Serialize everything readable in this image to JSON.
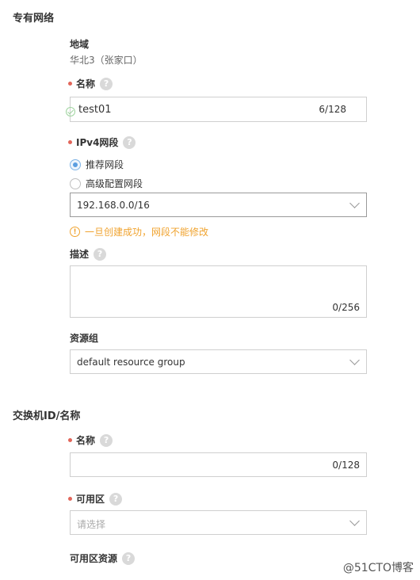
{
  "vpc": {
    "section_title": "专有网络",
    "region": {
      "label": "地域",
      "value": "华北3（张家口）"
    },
    "name": {
      "label": "名称",
      "value": "test01",
      "counter": "6/128"
    },
    "ipv4": {
      "label": "IPv4网段",
      "options": [
        {
          "label": "推荐网段",
          "checked": true
        },
        {
          "label": "高级配置网段",
          "checked": false
        }
      ],
      "selected": "192.168.0.0/16",
      "warning": "一旦创建成功，网段不能修改"
    },
    "description": {
      "label": "描述",
      "counter": "0/256"
    },
    "resource_group": {
      "label": "资源组",
      "selected": "default resource group"
    }
  },
  "vswitch": {
    "section_title": "交换机ID/名称",
    "name": {
      "label": "名称",
      "counter": "0/128"
    },
    "zone": {
      "label": "可用区",
      "placeholder": "请选择"
    },
    "zone_resource": {
      "label": "可用区资源"
    }
  },
  "watermark": "@51CTO博客",
  "help_glyph": "?",
  "warning_glyph": "!"
}
